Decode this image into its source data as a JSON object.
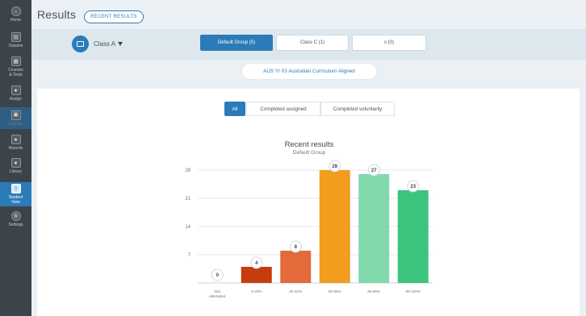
{
  "sidebar": {
    "items": [
      {
        "label": "Home",
        "icon": "home-icon"
      },
      {
        "label": "Classes",
        "icon": "classes-icon"
      },
      {
        "label": "Courses\n& Tests",
        "icon": "courses-icon"
      },
      {
        "label": "Assign",
        "icon": "assign-icon"
      },
      {
        "label": "Results",
        "icon": "results-icon",
        "state": "selected"
      },
      {
        "label": "Reports",
        "icon": "reports-icon"
      },
      {
        "label": "Library",
        "icon": "library-icon"
      },
      {
        "label": "Student\nView",
        "icon": "student-view-icon",
        "state": "active"
      },
      {
        "label": "Settings",
        "icon": "settings-icon"
      }
    ]
  },
  "header": {
    "title": "Results",
    "pill": "RECENT RESULTS"
  },
  "class_bar": {
    "class_name": "Class A",
    "groups": [
      {
        "label": "Default Group (5)",
        "active": true
      },
      {
        "label": "Class C (1)",
        "active": false
      },
      {
        "label": "s (0)",
        "active": false
      }
    ],
    "curriculum": "AUS Yr 03 Australian Curriculum Aligned"
  },
  "filters": [
    {
      "label": "All",
      "active": true
    },
    {
      "label": "Completed assigned",
      "active": false
    },
    {
      "label": "Completed voluntarily",
      "active": false
    }
  ],
  "colors": {
    "accent": "#2b7bb9",
    "rail": "#3c444b"
  },
  "chart_data": {
    "type": "bar",
    "title": "Recent results",
    "subtitle": "Default Group",
    "categories": [
      "Not\nattempted",
      "0-20%",
      "20-40%",
      "50-65%",
      "66-85%",
      "86-100%"
    ],
    "values": [
      0,
      4,
      8,
      28,
      27,
      23
    ],
    "colors": [
      "#bfc5ca",
      "#c73c0c",
      "#e36a3a",
      "#f39c1d",
      "#82d9ac",
      "#3cc47f"
    ],
    "yticks": [
      0,
      7,
      14,
      21,
      28
    ],
    "ytick_labels": [
      "7",
      "14",
      "21",
      "28"
    ],
    "ylim": [
      0,
      28
    ],
    "grid": true,
    "legend": "none",
    "xlabel": "",
    "ylabel": ""
  }
}
